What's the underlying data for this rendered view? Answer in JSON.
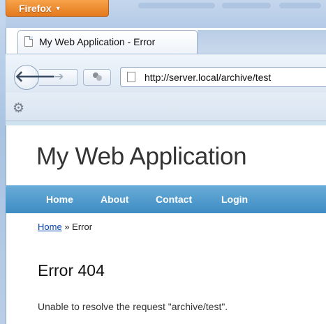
{
  "browser": {
    "menu_button_label": "Firefox",
    "tab_title": "My Web Application - Error",
    "url": "http://server.local/archive/test",
    "accent_color": "#e8841f"
  },
  "site": {
    "title": "My Web Application",
    "menu": [
      "Home",
      "About",
      "Contact",
      "Login"
    ],
    "menu_color": "#4f9bcf"
  },
  "breadcrumb": {
    "home_link": "Home",
    "separator": "»",
    "current": "Error"
  },
  "error": {
    "heading": "Error 404",
    "message": "Unable to resolve the request \"archive/test\"."
  }
}
